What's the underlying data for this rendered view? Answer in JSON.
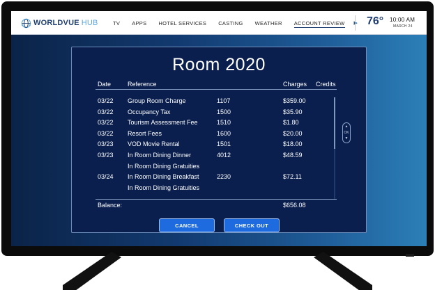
{
  "brand": {
    "name_bold": "WORLDVUE",
    "name_light": "HUB"
  },
  "nav": {
    "items": [
      {
        "label": "TV",
        "active": false
      },
      {
        "label": "APPS",
        "active": false
      },
      {
        "label": "HOTEL SERVICES",
        "active": false
      },
      {
        "label": "CASTING",
        "active": false
      },
      {
        "label": "WEATHER",
        "active": false
      },
      {
        "label": "ACCOUNT REVIEW",
        "active": true
      }
    ],
    "more_icon": "triangle-right-icon"
  },
  "status": {
    "temperature": "76°",
    "time": "10:00 AM",
    "date": "MARCH 24"
  },
  "folio": {
    "title": "Room 2020",
    "headers": {
      "date": "Date",
      "reference": "Reference",
      "charges": "Charges",
      "credits": "Credits"
    },
    "rows": [
      {
        "date": "03/22",
        "reference": "Group Room Charge",
        "code": "1107",
        "charge": "$359.00"
      },
      {
        "date": "03/22",
        "reference": "Occupancy Tax",
        "code": "1500",
        "charge": "$35.90"
      },
      {
        "date": "03/22",
        "reference": "Tourism Assessment Fee",
        "code": "1510",
        "charge": "$1.80"
      },
      {
        "date": "03/22",
        "reference": "Resort Fees",
        "code": "1600",
        "charge": "$20.00"
      },
      {
        "date": "03/23",
        "reference": "VOD Movie Rental",
        "code": "1501",
        "charge": "$18.00"
      },
      {
        "date": "03/23",
        "reference": "In Room Dining Dinner",
        "code": "4012",
        "charge": "$48.59"
      },
      {
        "date": "",
        "reference": "In Room Dining Gratuities",
        "code": "",
        "charge": ""
      },
      {
        "date": "03/24",
        "reference": "In Room Dining Breakfast",
        "code": "2230",
        "charge": "$72.11"
      },
      {
        "date": "",
        "reference": "In Room Dining Gratuities",
        "code": "",
        "charge": ""
      }
    ],
    "balance_label": "Balance:",
    "balance_value": "$656.08",
    "scroll_up_label": "▲",
    "scroll_mid_label": "OK",
    "scroll_down_label": "▼"
  },
  "buttons": {
    "cancel": "CANCEL",
    "checkout": "CHECK OUT"
  },
  "colors": {
    "accent": "#1e6be0",
    "panel": "#0a1f4e",
    "brand": "#1f3f72",
    "brand_light": "#5fa8dc",
    "bezel": "#0b0b0c"
  }
}
